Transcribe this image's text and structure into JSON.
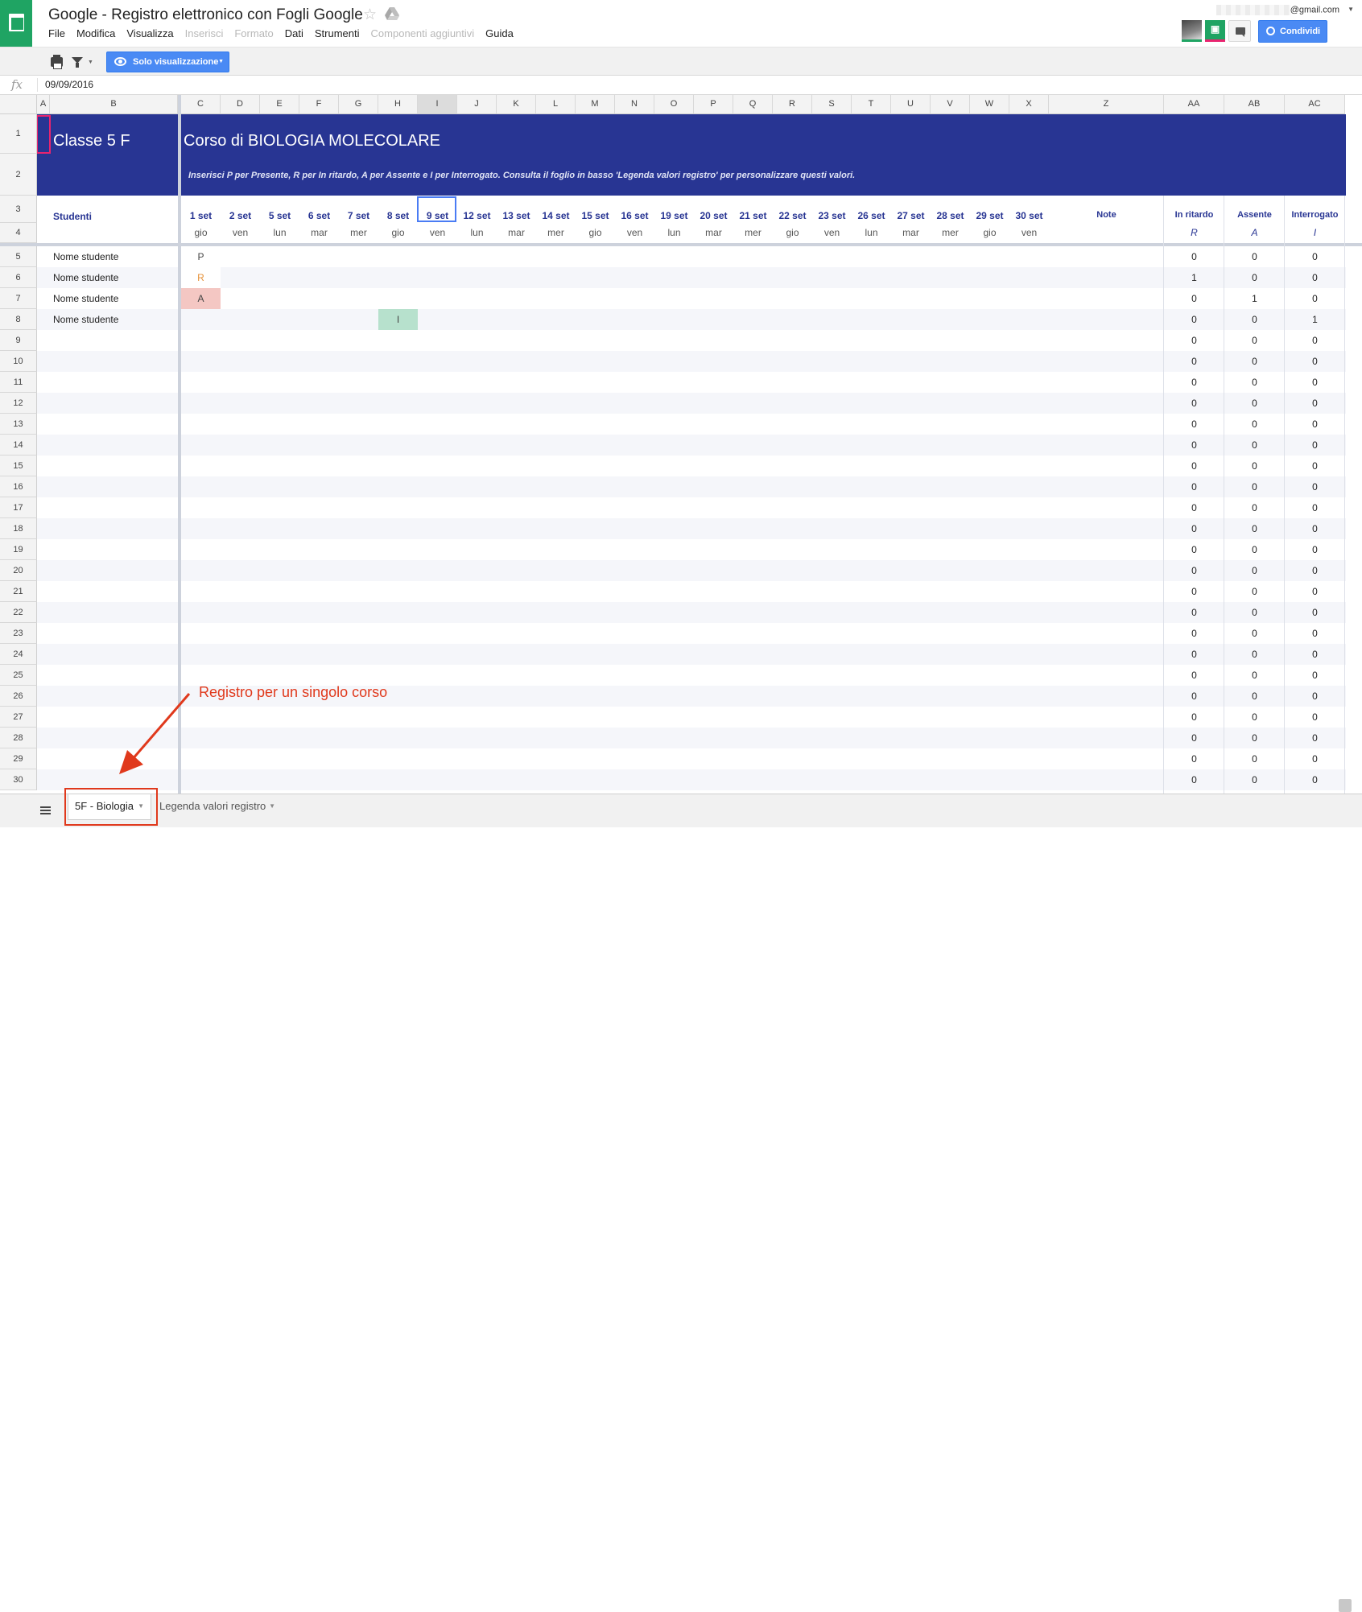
{
  "header": {
    "title": "Google - Registro elettronico con Fogli Google",
    "account": "@gmail.com",
    "share_label": "Condividi",
    "menus": [
      {
        "label": "File",
        "enabled": true
      },
      {
        "label": "Modifica",
        "enabled": true
      },
      {
        "label": "Visualizza",
        "enabled": true
      },
      {
        "label": "Inserisci",
        "enabled": false
      },
      {
        "label": "Formato",
        "enabled": false
      },
      {
        "label": "Dati",
        "enabled": true
      },
      {
        "label": "Strumenti",
        "enabled": true
      },
      {
        "label": "Componenti aggiuntivi",
        "enabled": false
      },
      {
        "label": "Guida",
        "enabled": true
      }
    ]
  },
  "toolbar": {
    "mode_label": "Solo visualizzazione"
  },
  "formula_bar": {
    "value": "09/09/2016"
  },
  "columns": [
    "A",
    "B",
    "C",
    "D",
    "E",
    "F",
    "G",
    "H",
    "I",
    "J",
    "K",
    "L",
    "M",
    "N",
    "O",
    "P",
    "Q",
    "R",
    "S",
    "T",
    "U",
    "V",
    "W",
    "X",
    "Z",
    "AA",
    "AB",
    "AC"
  ],
  "selected_column": "I",
  "rows": [
    "1",
    "2",
    "3",
    "4",
    "5",
    "6",
    "7",
    "8",
    "9",
    "10",
    "11",
    "12",
    "13",
    "14",
    "15",
    "16",
    "17",
    "18",
    "19",
    "20",
    "21",
    "22",
    "23",
    "24",
    "25",
    "26",
    "27",
    "28",
    "29",
    "30"
  ],
  "sheet": {
    "class_title": "Classe 5 F",
    "course_title": "Corso di BIOLOGIA MOLECOLARE",
    "instructions": "Inserisci P per Presente, R per In ritardo, A per Assente e I per Interrogato. Consulta il foglio in basso 'Legenda valori registro' per personalizzare questi valori.",
    "students_header": "Studenti",
    "notes_header": "Note",
    "dates": [
      {
        "date": "1 set",
        "day": "gio"
      },
      {
        "date": "2 set",
        "day": "ven"
      },
      {
        "date": "5 set",
        "day": "lun"
      },
      {
        "date": "6 set",
        "day": "mar"
      },
      {
        "date": "7 set",
        "day": "mer"
      },
      {
        "date": "8 set",
        "day": "gio"
      },
      {
        "date": "9 set",
        "day": "ven"
      },
      {
        "date": "12 set",
        "day": "lun"
      },
      {
        "date": "13 set",
        "day": "mar"
      },
      {
        "date": "14 set",
        "day": "mer"
      },
      {
        "date": "15 set",
        "day": "gio"
      },
      {
        "date": "16 set",
        "day": "ven"
      },
      {
        "date": "19 set",
        "day": "lun"
      },
      {
        "date": "20 set",
        "day": "mar"
      },
      {
        "date": "21 set",
        "day": "mer"
      },
      {
        "date": "22 set",
        "day": "gio"
      },
      {
        "date": "23 set",
        "day": "ven"
      },
      {
        "date": "26 set",
        "day": "lun"
      },
      {
        "date": "27 set",
        "day": "mar"
      },
      {
        "date": "28 set",
        "day": "mer"
      },
      {
        "date": "29 set",
        "day": "gio"
      },
      {
        "date": "30 set",
        "day": "ven"
      }
    ],
    "summary_headers": [
      {
        "label": "In ritardo",
        "code": "R"
      },
      {
        "label": "Assente",
        "code": "A"
      },
      {
        "label": "Interrogato",
        "code": "I"
      }
    ],
    "students": [
      "Nome studente",
      "Nome studente",
      "Nome studente",
      "Nome studente"
    ],
    "marks": [
      {
        "row": 0,
        "date_index": 0,
        "value": "P",
        "color": "#444444",
        "bg": "#ffffff"
      },
      {
        "row": 1,
        "date_index": 0,
        "value": "R",
        "color": "#e69138",
        "bg": "#ffffff"
      },
      {
        "row": 2,
        "date_index": 0,
        "value": "A",
        "color": "#444444",
        "bg": "#f4c7c3"
      },
      {
        "row": 3,
        "date_index": 5,
        "value": "I",
        "color": "#444444",
        "bg": "#b7e1cd"
      }
    ],
    "summary": [
      [
        "0",
        "0",
        "0"
      ],
      [
        "1",
        "0",
        "0"
      ],
      [
        "0",
        "1",
        "0"
      ],
      [
        "0",
        "0",
        "1"
      ],
      [
        "0",
        "0",
        "0"
      ],
      [
        "0",
        "0",
        "0"
      ],
      [
        "0",
        "0",
        "0"
      ],
      [
        "0",
        "0",
        "0"
      ],
      [
        "0",
        "0",
        "0"
      ],
      [
        "0",
        "0",
        "0"
      ],
      [
        "0",
        "0",
        "0"
      ],
      [
        "0",
        "0",
        "0"
      ],
      [
        "0",
        "0",
        "0"
      ],
      [
        "0",
        "0",
        "0"
      ],
      [
        "0",
        "0",
        "0"
      ],
      [
        "0",
        "0",
        "0"
      ],
      [
        "0",
        "0",
        "0"
      ],
      [
        "0",
        "0",
        "0"
      ],
      [
        "0",
        "0",
        "0"
      ],
      [
        "0",
        "0",
        "0"
      ],
      [
        "0",
        "0",
        "0"
      ],
      [
        "0",
        "0",
        "0"
      ],
      [
        "0",
        "0",
        "0"
      ],
      [
        "0",
        "0",
        "0"
      ],
      [
        "0",
        "0",
        "0"
      ],
      [
        "0",
        "0",
        "0"
      ]
    ],
    "colors": {
      "banner": "#283593",
      "accent": "#4a8af4",
      "annotation": "#e0391c"
    }
  },
  "annotation": {
    "text": "Registro per un singolo corso"
  },
  "tabs": [
    {
      "label": "5F - Biologia",
      "active": true
    },
    {
      "label": "Legenda valori registro",
      "active": false
    }
  ]
}
